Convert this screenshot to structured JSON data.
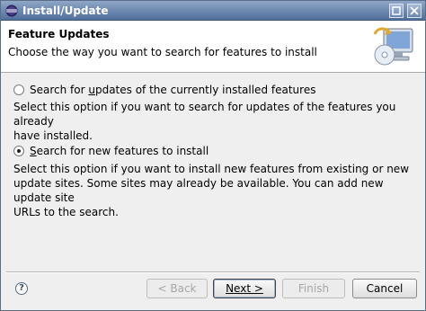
{
  "window": {
    "title": "Install/Update"
  },
  "icons": {
    "app": "eclipse-icon",
    "banner": "computer-update-icon",
    "help": "help-icon"
  },
  "banner": {
    "title": "Feature Updates",
    "description": "Choose the way you want to search for features to install"
  },
  "options": [
    {
      "label_before": "Search for ",
      "label_mnemonic": "u",
      "label_after": "pdates of the currently installed features",
      "selected": false,
      "description_lines": [
        "Select this option if you want to search for updates of the features you already",
        "have installed."
      ]
    },
    {
      "label_before": "",
      "label_mnemonic": "S",
      "label_after": "earch for new features to install",
      "selected": true,
      "description_lines": [
        "Select this option if you want to install new features from existing or new",
        "update sites. Some sites may already be available. You can add new update site",
        "URLs to the search."
      ]
    }
  ],
  "buttons": {
    "back": "< Back",
    "next": "Next >",
    "finish": "Finish",
    "cancel": "Cancel",
    "help": "?"
  }
}
